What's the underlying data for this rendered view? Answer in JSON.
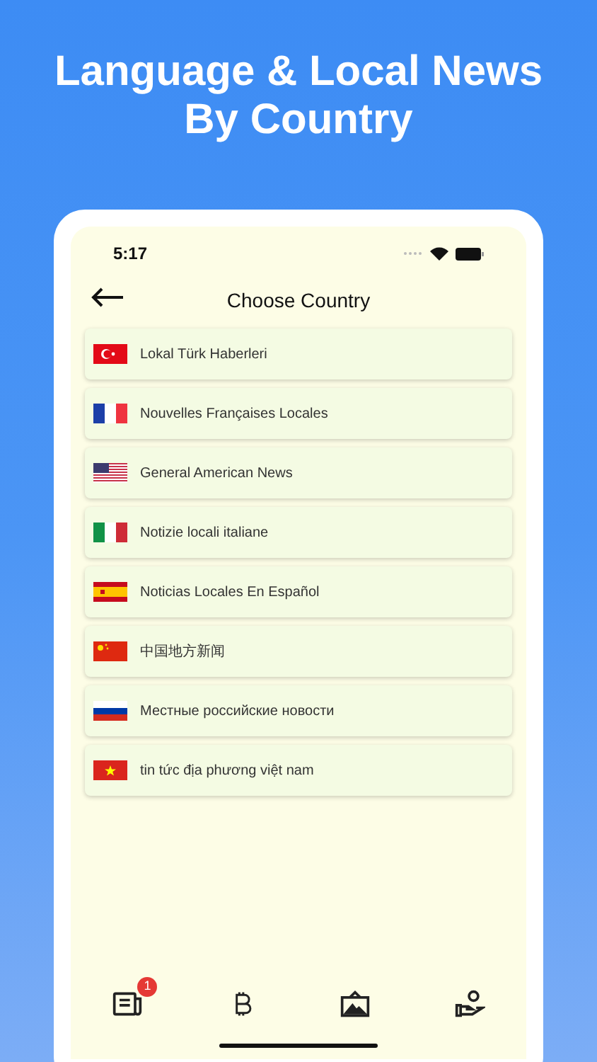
{
  "headline": {
    "lines": [
      "Language & Local News",
      "By Country"
    ]
  },
  "status_bar": {
    "time": "5:17"
  },
  "header": {
    "title": "Choose Country"
  },
  "countries": [
    {
      "label": "Lokal Türk Haberleri"
    },
    {
      "label": "Nouvelles Françaises Locales"
    },
    {
      "label": "General American News"
    },
    {
      "label": "Notizie locali italiane"
    },
    {
      "label": "Noticias Locales En Español"
    },
    {
      "label": "中国地方新闻"
    },
    {
      "label": "Местные российские новости"
    },
    {
      "label": "tin tức địa phương việt nam"
    }
  ],
  "tab_bar": {
    "first_tab_badge": "1"
  }
}
